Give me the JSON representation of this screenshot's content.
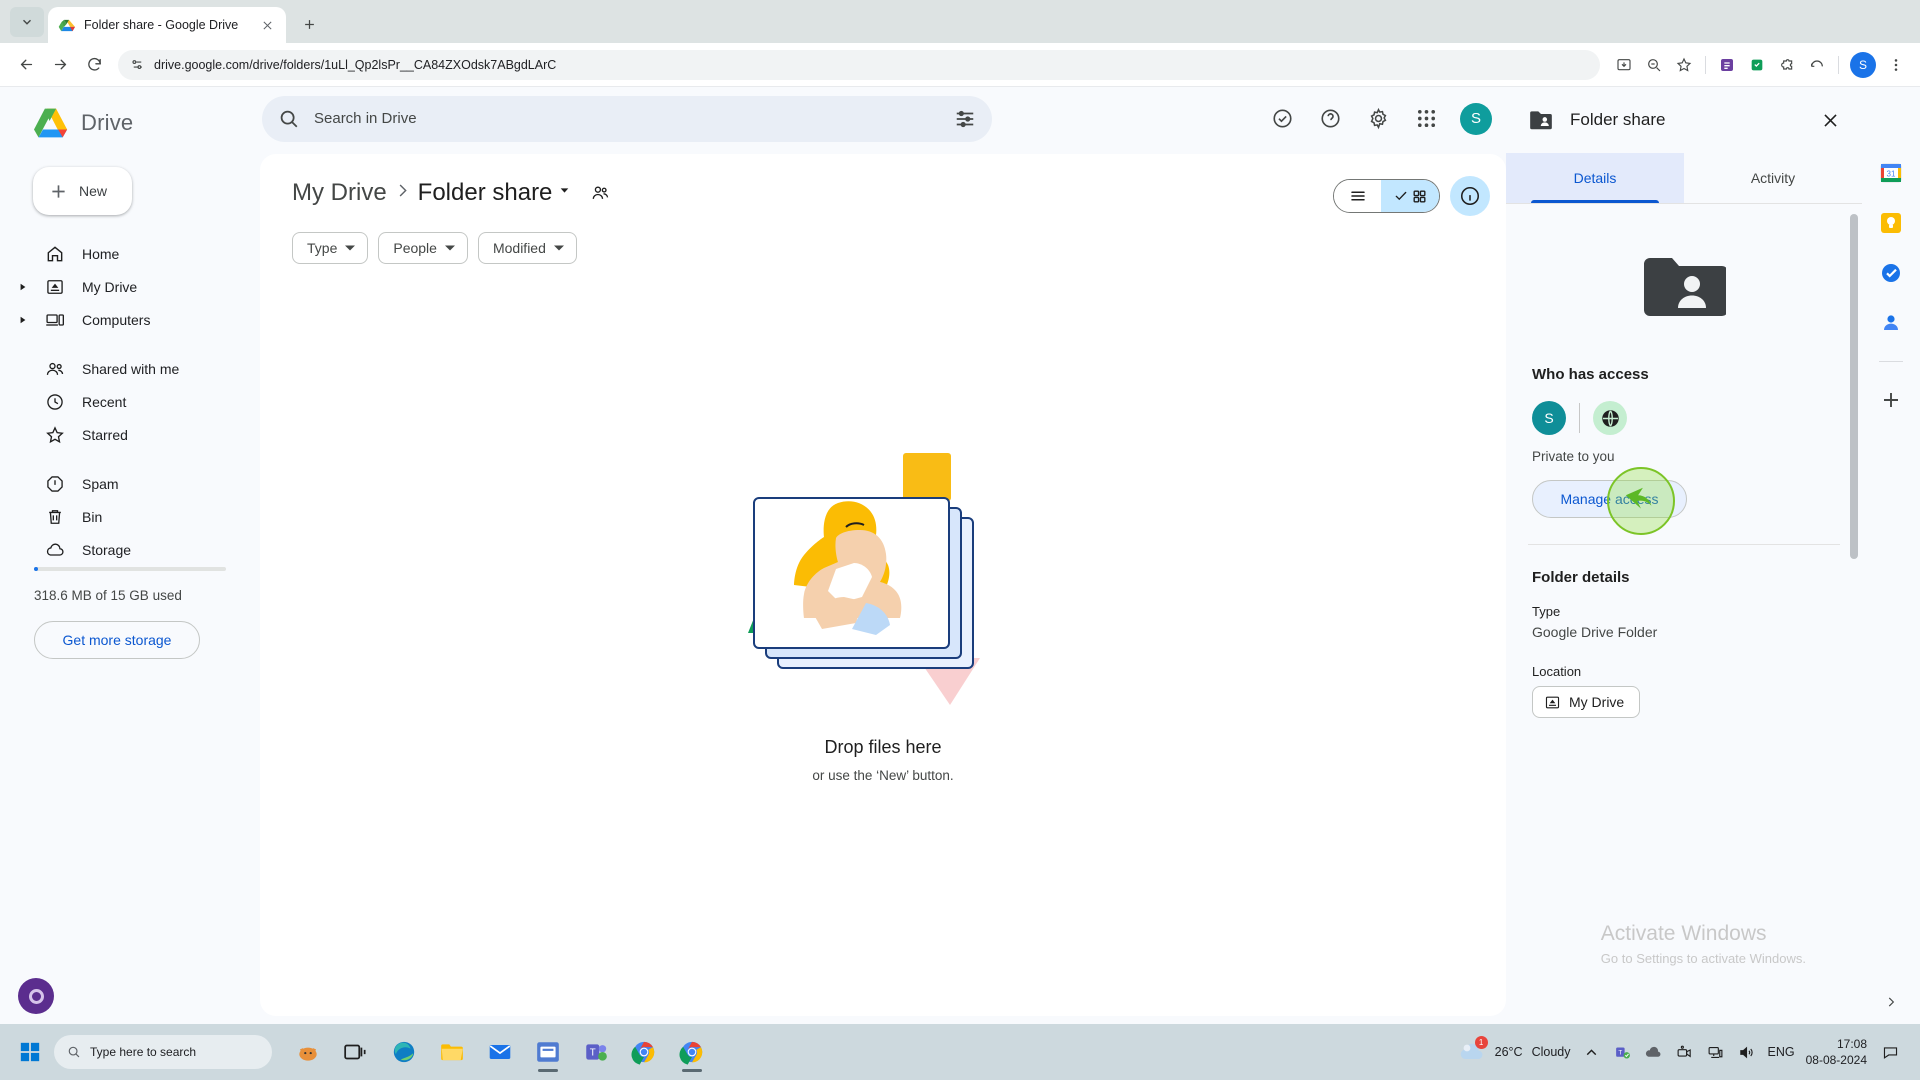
{
  "browser": {
    "tab": {
      "title": "Folder share - Google Drive",
      "favicon": "drive-logo-icon"
    },
    "new_tab_label": "+",
    "url": "drive.google.com/drive/folders/1uLl_Qp2lsPr__CA84ZXOdsk7ABgdLArC",
    "profile_initial": "S"
  },
  "drive": {
    "logo_text": "Drive",
    "new_button": "New",
    "nav": [
      {
        "label": "Home",
        "icon": "home-icon",
        "expandable": false
      },
      {
        "label": "My Drive",
        "icon": "my-drive-icon",
        "expandable": true
      },
      {
        "label": "Computers",
        "icon": "computers-icon",
        "expandable": true
      },
      {
        "label": "Shared with me",
        "icon": "shared-with-me-icon",
        "expandable": false
      },
      {
        "label": "Recent",
        "icon": "clock-icon",
        "expandable": false
      },
      {
        "label": "Starred",
        "icon": "star-icon",
        "expandable": false
      },
      {
        "label": "Spam",
        "icon": "spam-icon",
        "expandable": false
      },
      {
        "label": "Bin",
        "icon": "trash-icon",
        "expandable": false
      },
      {
        "label": "Storage",
        "icon": "cloud-icon",
        "expandable": false
      }
    ],
    "storage": {
      "used_text": "318.6 MB of 15 GB used",
      "get_more_label": "Get more storage",
      "percent": 2
    },
    "search": {
      "placeholder": "Search in Drive",
      "value": ""
    },
    "breadcrumb": {
      "root": "My Drive",
      "current": "Folder share"
    },
    "filters": [
      {
        "label": "Type"
      },
      {
        "label": "People"
      },
      {
        "label": "Modified"
      }
    ],
    "view": {
      "list_label": "List view",
      "grid_label": "Grid view",
      "active": "grid"
    },
    "empty_state": {
      "title": "Drop files here",
      "subtitle": "or use the ‘New’ button."
    },
    "account_initial": "S"
  },
  "details_panel": {
    "title": "Folder share",
    "tabs": [
      {
        "label": "Details",
        "active": true
      },
      {
        "label": "Activity",
        "active": false
      }
    ],
    "who_has_access": {
      "heading": "Who has access",
      "owner_initial": "S",
      "note": "Private to you",
      "manage_button": "Manage access"
    },
    "folder_details": {
      "heading": "Folder details",
      "type_label": "Type",
      "type_value": "Google Drive Folder",
      "location_label": "Location",
      "location_value": "My Drive"
    }
  },
  "watermark": {
    "line1": "Activate Windows",
    "line2": "Go to Settings to activate Windows."
  },
  "taskbar": {
    "search_placeholder": "Type here to search",
    "weather_temp": "26°C",
    "weather_desc": "Cloudy",
    "weather_badge": "1",
    "language": "ENG",
    "time": "17:08",
    "date": "08-08-2024"
  },
  "colors": {
    "accent_blue": "#0b57d0",
    "chip_blue": "#c2e7ff",
    "avatar_teal": "#0f8e98",
    "globe_green": "#c4eed0",
    "cursor_green": "#7cc427"
  }
}
